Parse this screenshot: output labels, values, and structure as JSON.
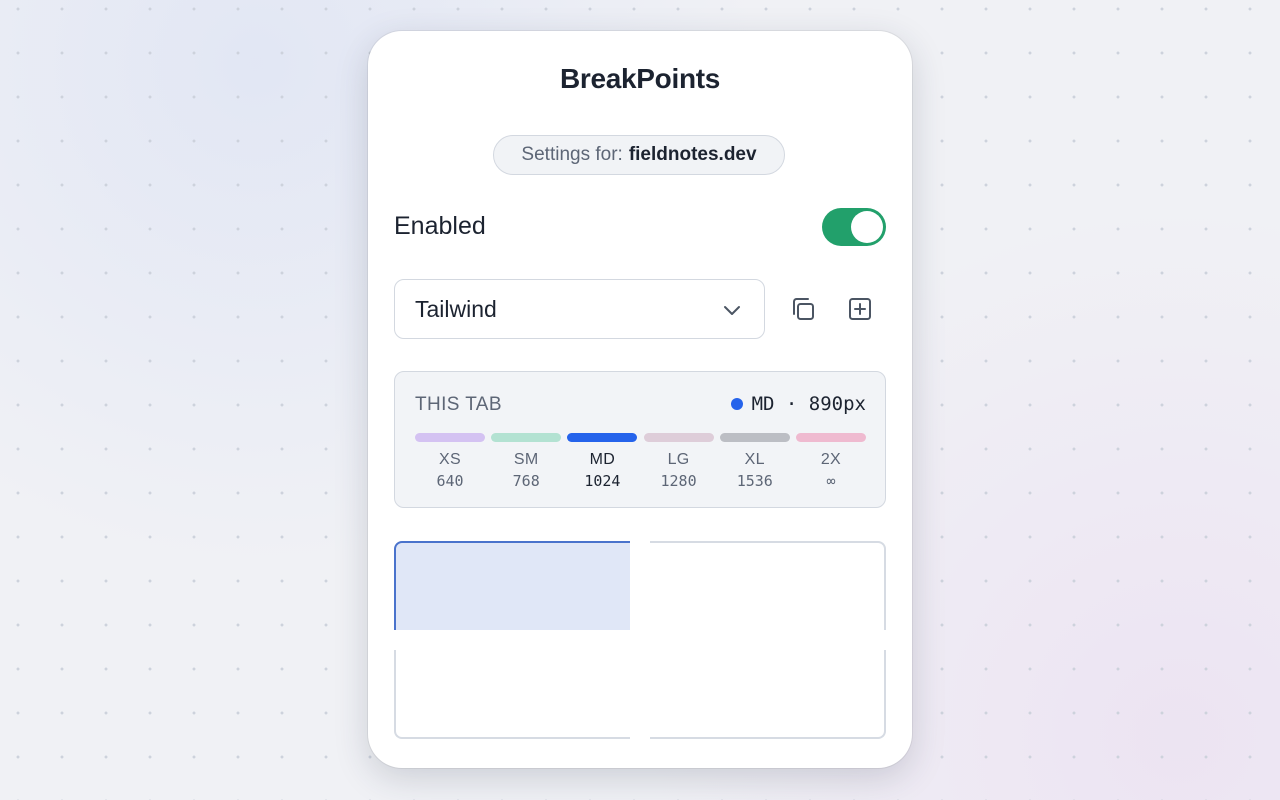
{
  "app": {
    "title": "BreakPoints"
  },
  "settings": {
    "prefix": "Settings for:",
    "domain": "fieldnotes.dev"
  },
  "enabled": {
    "label": "Enabled",
    "value": true,
    "color": "#22a06b"
  },
  "preset": {
    "selected": "Tailwind",
    "chevron_icon": "chevron-down-icon",
    "copy_icon": "copy-icon",
    "add_icon": "plus-square-icon"
  },
  "this_tab": {
    "label": "THIS TAB",
    "current": "MD · 890px",
    "current_color": "#2563eb",
    "breakpoints": [
      {
        "name": "XS",
        "size": "640",
        "color": "#d4c2f2",
        "active": false
      },
      {
        "name": "SM",
        "size": "768",
        "color": "#b3e2d2",
        "active": false
      },
      {
        "name": "MD",
        "size": "1024",
        "color": "#2563eb",
        "active": true
      },
      {
        "name": "LG",
        "size": "1280",
        "color": "#decdd9",
        "active": false
      },
      {
        "name": "XL",
        "size": "1536",
        "color": "#bcbec4",
        "active": false
      },
      {
        "name": "2X",
        "size": "∞",
        "color": "#efbad0",
        "active": false
      }
    ]
  },
  "preview": {
    "highlight_color": "#e0e7f7",
    "highlight_border": "#4a73cc"
  }
}
